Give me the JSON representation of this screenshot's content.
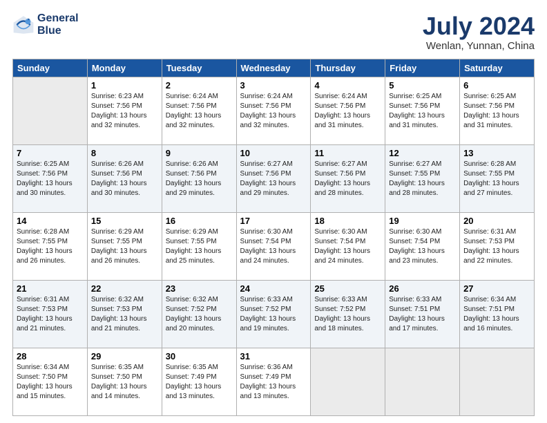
{
  "logo": {
    "line1": "General",
    "line2": "Blue"
  },
  "title": "July 2024",
  "subtitle": "Wenlan, Yunnan, China",
  "headers": [
    "Sunday",
    "Monday",
    "Tuesday",
    "Wednesday",
    "Thursday",
    "Friday",
    "Saturday"
  ],
  "weeks": [
    [
      {
        "day": "",
        "info": ""
      },
      {
        "day": "1",
        "info": "Sunrise: 6:23 AM\nSunset: 7:56 PM\nDaylight: 13 hours\nand 32 minutes."
      },
      {
        "day": "2",
        "info": "Sunrise: 6:24 AM\nSunset: 7:56 PM\nDaylight: 13 hours\nand 32 minutes."
      },
      {
        "day": "3",
        "info": "Sunrise: 6:24 AM\nSunset: 7:56 PM\nDaylight: 13 hours\nand 32 minutes."
      },
      {
        "day": "4",
        "info": "Sunrise: 6:24 AM\nSunset: 7:56 PM\nDaylight: 13 hours\nand 31 minutes."
      },
      {
        "day": "5",
        "info": "Sunrise: 6:25 AM\nSunset: 7:56 PM\nDaylight: 13 hours\nand 31 minutes."
      },
      {
        "day": "6",
        "info": "Sunrise: 6:25 AM\nSunset: 7:56 PM\nDaylight: 13 hours\nand 31 minutes."
      }
    ],
    [
      {
        "day": "7",
        "info": "Sunrise: 6:25 AM\nSunset: 7:56 PM\nDaylight: 13 hours\nand 30 minutes."
      },
      {
        "day": "8",
        "info": "Sunrise: 6:26 AM\nSunset: 7:56 PM\nDaylight: 13 hours\nand 30 minutes."
      },
      {
        "day": "9",
        "info": "Sunrise: 6:26 AM\nSunset: 7:56 PM\nDaylight: 13 hours\nand 29 minutes."
      },
      {
        "day": "10",
        "info": "Sunrise: 6:27 AM\nSunset: 7:56 PM\nDaylight: 13 hours\nand 29 minutes."
      },
      {
        "day": "11",
        "info": "Sunrise: 6:27 AM\nSunset: 7:56 PM\nDaylight: 13 hours\nand 28 minutes."
      },
      {
        "day": "12",
        "info": "Sunrise: 6:27 AM\nSunset: 7:55 PM\nDaylight: 13 hours\nand 28 minutes."
      },
      {
        "day": "13",
        "info": "Sunrise: 6:28 AM\nSunset: 7:55 PM\nDaylight: 13 hours\nand 27 minutes."
      }
    ],
    [
      {
        "day": "14",
        "info": "Sunrise: 6:28 AM\nSunset: 7:55 PM\nDaylight: 13 hours\nand 26 minutes."
      },
      {
        "day": "15",
        "info": "Sunrise: 6:29 AM\nSunset: 7:55 PM\nDaylight: 13 hours\nand 26 minutes."
      },
      {
        "day": "16",
        "info": "Sunrise: 6:29 AM\nSunset: 7:55 PM\nDaylight: 13 hours\nand 25 minutes."
      },
      {
        "day": "17",
        "info": "Sunrise: 6:30 AM\nSunset: 7:54 PM\nDaylight: 13 hours\nand 24 minutes."
      },
      {
        "day": "18",
        "info": "Sunrise: 6:30 AM\nSunset: 7:54 PM\nDaylight: 13 hours\nand 24 minutes."
      },
      {
        "day": "19",
        "info": "Sunrise: 6:30 AM\nSunset: 7:54 PM\nDaylight: 13 hours\nand 23 minutes."
      },
      {
        "day": "20",
        "info": "Sunrise: 6:31 AM\nSunset: 7:53 PM\nDaylight: 13 hours\nand 22 minutes."
      }
    ],
    [
      {
        "day": "21",
        "info": "Sunrise: 6:31 AM\nSunset: 7:53 PM\nDaylight: 13 hours\nand 21 minutes."
      },
      {
        "day": "22",
        "info": "Sunrise: 6:32 AM\nSunset: 7:53 PM\nDaylight: 13 hours\nand 21 minutes."
      },
      {
        "day": "23",
        "info": "Sunrise: 6:32 AM\nSunset: 7:52 PM\nDaylight: 13 hours\nand 20 minutes."
      },
      {
        "day": "24",
        "info": "Sunrise: 6:33 AM\nSunset: 7:52 PM\nDaylight: 13 hours\nand 19 minutes."
      },
      {
        "day": "25",
        "info": "Sunrise: 6:33 AM\nSunset: 7:52 PM\nDaylight: 13 hours\nand 18 minutes."
      },
      {
        "day": "26",
        "info": "Sunrise: 6:33 AM\nSunset: 7:51 PM\nDaylight: 13 hours\nand 17 minutes."
      },
      {
        "day": "27",
        "info": "Sunrise: 6:34 AM\nSunset: 7:51 PM\nDaylight: 13 hours\nand 16 minutes."
      }
    ],
    [
      {
        "day": "28",
        "info": "Sunrise: 6:34 AM\nSunset: 7:50 PM\nDaylight: 13 hours\nand 15 minutes."
      },
      {
        "day": "29",
        "info": "Sunrise: 6:35 AM\nSunset: 7:50 PM\nDaylight: 13 hours\nand 14 minutes."
      },
      {
        "day": "30",
        "info": "Sunrise: 6:35 AM\nSunset: 7:49 PM\nDaylight: 13 hours\nand 13 minutes."
      },
      {
        "day": "31",
        "info": "Sunrise: 6:36 AM\nSunset: 7:49 PM\nDaylight: 13 hours\nand 13 minutes."
      },
      {
        "day": "",
        "info": ""
      },
      {
        "day": "",
        "info": ""
      },
      {
        "day": "",
        "info": ""
      }
    ]
  ]
}
